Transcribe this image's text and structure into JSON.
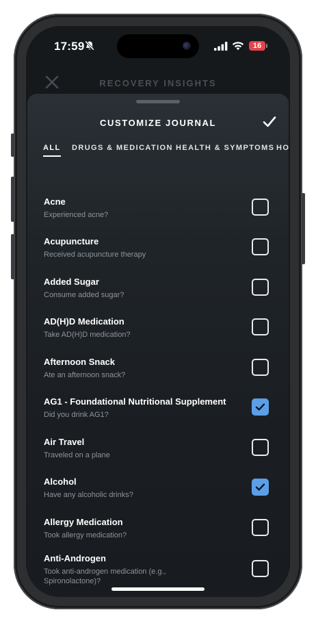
{
  "status_bar": {
    "time": "17:59",
    "battery": "16"
  },
  "background_header": {
    "title": "RECOVERY INSIGHTS"
  },
  "sheet": {
    "title": "CUSTOMIZE JOURNAL",
    "tabs": [
      {
        "label": "ALL",
        "active": true
      },
      {
        "label": "DRUGS & MEDICATION",
        "active": false
      },
      {
        "label": "HEALTH & SYMPTOMS",
        "active": false
      },
      {
        "label": "HO",
        "active": false
      }
    ],
    "items": [
      {
        "title": "Acne",
        "subtitle": "Experienced acne?",
        "checked": false
      },
      {
        "title": "Acupuncture",
        "subtitle": "Received acupuncture therapy",
        "checked": false
      },
      {
        "title": "Added Sugar",
        "subtitle": "Consume added sugar?",
        "checked": false
      },
      {
        "title": "AD(H)D Medication",
        "subtitle": "Take AD(H)D medication?",
        "checked": false
      },
      {
        "title": "Afternoon Snack",
        "subtitle": "Ate an afternoon snack?",
        "checked": false
      },
      {
        "title": "AG1 - Foundational Nutritional Supplement",
        "subtitle": "Did you drink AG1?",
        "checked": true
      },
      {
        "title": "Air Travel",
        "subtitle": "Traveled on a plane",
        "checked": false
      },
      {
        "title": "Alcohol",
        "subtitle": "Have any alcoholic drinks?",
        "checked": true
      },
      {
        "title": "Allergy Medication",
        "subtitle": "Took allergy medication?",
        "checked": false
      },
      {
        "title": "Anti-Androgen",
        "subtitle": "Took anti-androgen medication (e.g., Spironolactone)?",
        "checked": false
      }
    ]
  },
  "colors": {
    "accent": "#5a9fe8",
    "background": "#16191c",
    "subtitle": "#8c949c"
  },
  "icons": {
    "close": "close-icon",
    "done": "checkmark-icon",
    "silent": "bell-slash-icon"
  }
}
